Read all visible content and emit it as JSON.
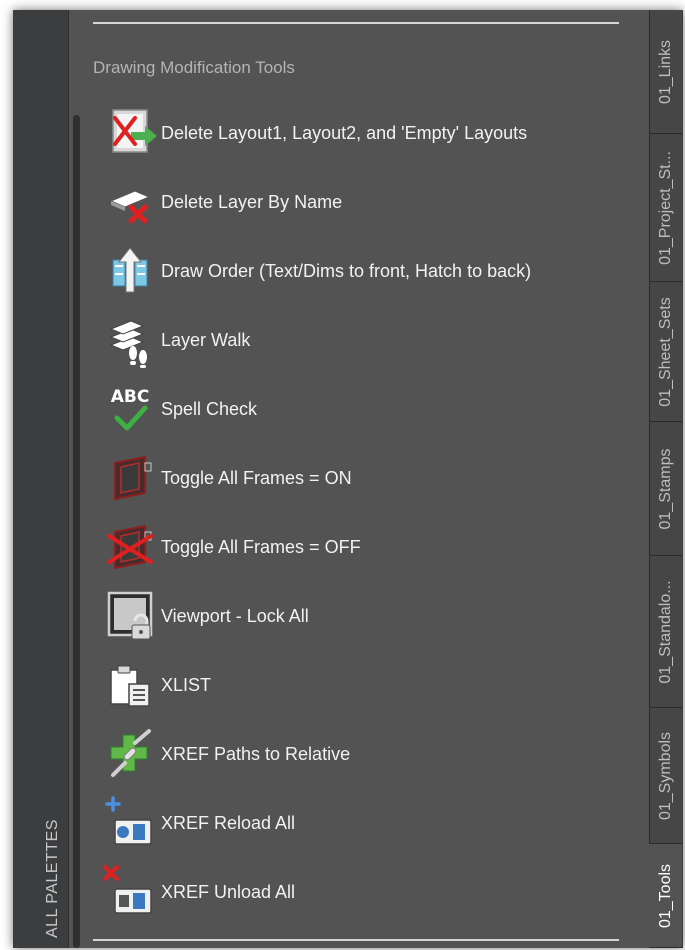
{
  "palette": {
    "title": "ALL PALETTES",
    "section_header": "Drawing Modification Tools"
  },
  "tools": [
    {
      "label": "Delete Layout1, Layout2, and 'Empty' Layouts",
      "icon": "delete-layouts-icon"
    },
    {
      "label": "Delete Layer By Name",
      "icon": "delete-layer-icon"
    },
    {
      "label": "Draw Order (Text/Dims to front, Hatch to back)",
      "icon": "draw-order-icon"
    },
    {
      "label": "Layer Walk",
      "icon": "layer-walk-icon"
    },
    {
      "label": "Spell Check",
      "icon": "spell-check-icon",
      "icon_text": "ABC"
    },
    {
      "label": "Toggle All Frames = ON",
      "icon": "frames-on-icon"
    },
    {
      "label": "Toggle All Frames = OFF",
      "icon": "frames-off-icon"
    },
    {
      "label": "Viewport - Lock All",
      "icon": "viewport-lock-icon"
    },
    {
      "label": "XLIST",
      "icon": "xlist-icon"
    },
    {
      "label": "XREF Paths to Relative",
      "icon": "xref-relative-icon"
    },
    {
      "label": "XREF Reload All",
      "icon": "xref-reload-icon"
    },
    {
      "label": "XREF Unload All",
      "icon": "xref-unload-icon"
    }
  ],
  "tabs": [
    {
      "label": "01_Links"
    },
    {
      "label": "01_Project_St..."
    },
    {
      "label": "01_Sheet_Sets"
    },
    {
      "label": "01_Stamps"
    },
    {
      "label": "01_Standalo..."
    },
    {
      "label": "01_Symbols"
    },
    {
      "label": "01_Tools",
      "active": true
    }
  ],
  "colors": {
    "content_bg": "#535353",
    "strip_bg": "#3b3d3f",
    "tab_bg": "#464646",
    "active_tab_bg": "#535353",
    "delete_red": "#e02020",
    "check_green": "#3cb043"
  }
}
